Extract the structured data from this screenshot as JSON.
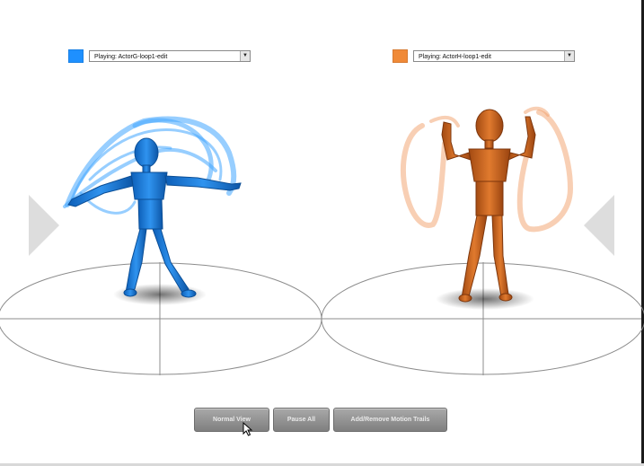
{
  "left_actor": {
    "selected_value": "Playing: ActorG-loop1-edit",
    "color": "#1e90ff"
  },
  "right_actor": {
    "selected_value": "Playing: ActorH-loop1-edit",
    "color": "#f08a38"
  },
  "icons": {
    "left_nav": "triangle-left-icon",
    "right_nav": "triangle-right-icon",
    "dropdown": "chevron-down-icon",
    "cursor": "mouse-pointer-icon"
  },
  "toolbar": {
    "normal_view_label": "Normal View",
    "pause_all_label": "Pause All",
    "motion_trails_label": "Add/Remove Motion Trails"
  }
}
